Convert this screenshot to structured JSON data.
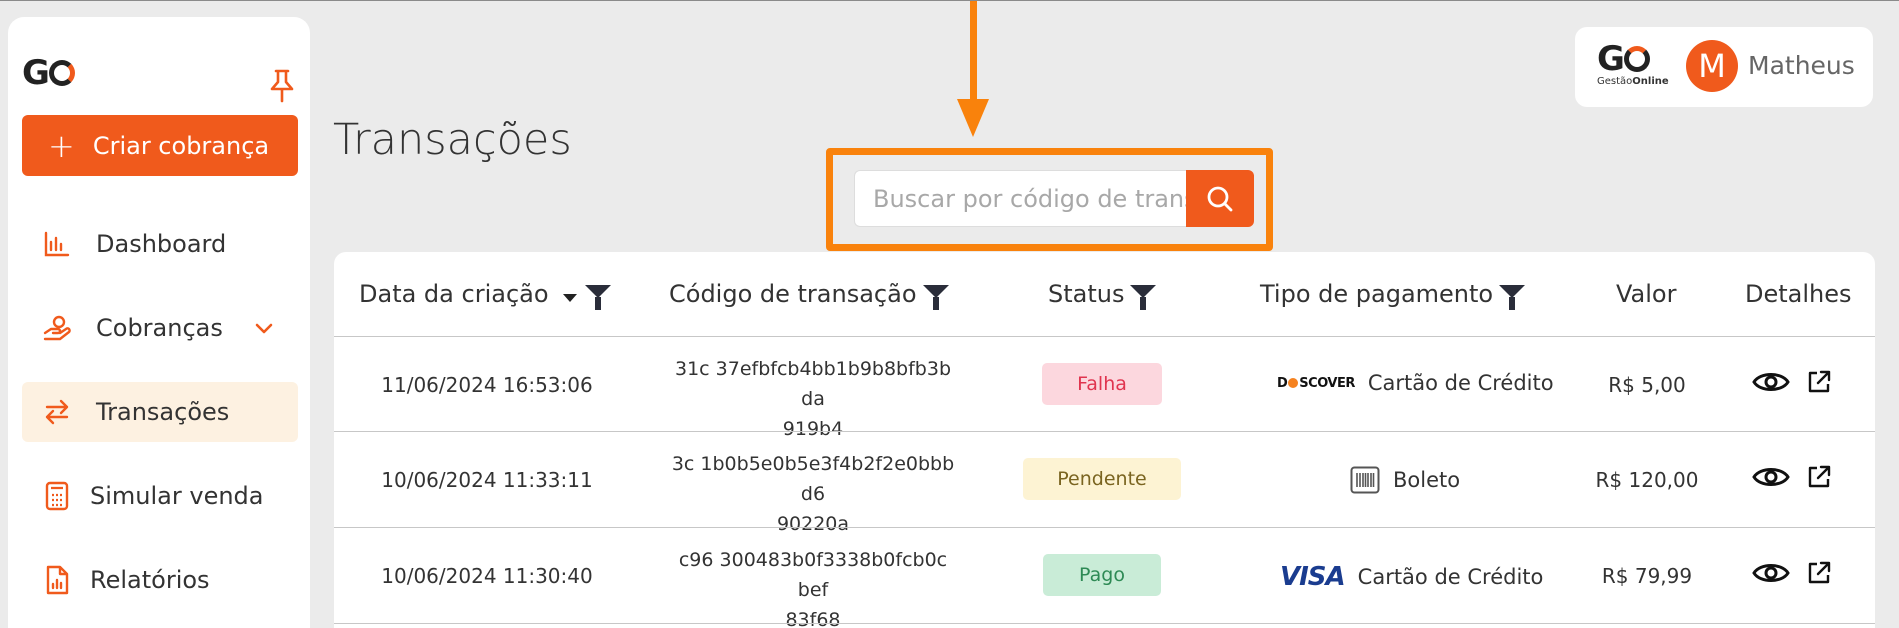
{
  "app": {
    "logo_text": "G"
  },
  "sidebar": {
    "create_label": "Criar cobrança",
    "items": [
      {
        "label": "Dashboard",
        "icon": "bar-chart-icon"
      },
      {
        "label": "Cobranças",
        "icon": "hand-coin-icon"
      },
      {
        "label": "Transações",
        "icon": "transfer-arrows-icon"
      },
      {
        "label": "Simular venda",
        "icon": "calculator-icon"
      },
      {
        "label": "Relatórios",
        "icon": "report-icon"
      }
    ]
  },
  "page": {
    "title": "Transações"
  },
  "search": {
    "placeholder": "Buscar por código de transação"
  },
  "user": {
    "brand_text": "G",
    "brand_sub_a": "Gestão",
    "brand_sub_b": "Online",
    "initial": "M",
    "name": "Matheus"
  },
  "table": {
    "headers": [
      "Data da criação",
      "Código de transação",
      "Status",
      "Tipo de pagamento",
      "Valor",
      "Detalhes"
    ],
    "rows": [
      {
        "date": "11/06/2024 16:53:06",
        "code_line1": "31c 37efbfcb4bb1b9b8bfb3b da",
        "code_line2": "919b4",
        "status": "Falha",
        "payment_brand": "DISCOVER",
        "payment": "Cartão de Crédito",
        "value": "R$ 5,00"
      },
      {
        "date": "10/06/2024 11:33:11",
        "code_line1": "3c 1b0b5e0b5e3f4b2f2e0bbb d6",
        "code_line2": "90220a",
        "status": "Pendente",
        "payment_brand": "",
        "payment": "Boleto",
        "value": "R$ 120,00"
      },
      {
        "date": "10/06/2024 11:30:40",
        "code_line1": "c96 300483b0f3338b0fcb0c bef",
        "code_line2": "83f68",
        "status": "Pago",
        "payment_brand": "VISA",
        "payment": "Cartão de Crédito",
        "value": "R$ 79,99"
      }
    ]
  },
  "colors": {
    "accent": "#f05a1c",
    "highlight": "#f9820c",
    "fail_bg": "#fcd7de",
    "fail_text": "#e0344f",
    "pending_bg": "#fdf3d3",
    "pending_text": "#7a6420",
    "paid_bg": "#c9ecd7",
    "paid_text": "#2e8a55"
  }
}
